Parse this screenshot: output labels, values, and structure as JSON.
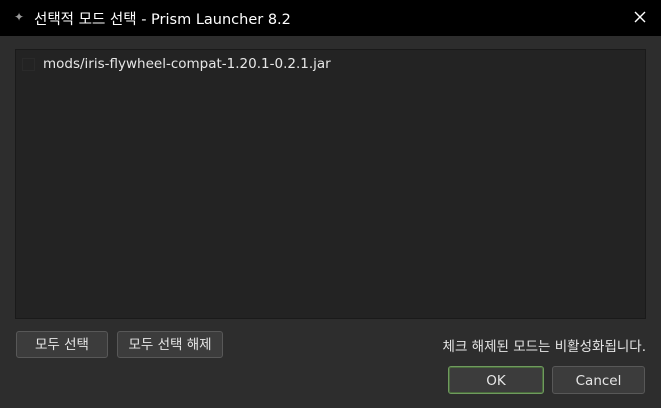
{
  "window": {
    "title": "선택적 모드 선택 - Prism Launcher 8.2",
    "app_icon": "prism-launcher-icon",
    "close_icon": "close-icon"
  },
  "mod_list": {
    "items": [
      {
        "label": "mods/iris-flywheel-compat-1.20.1-0.2.1.jar",
        "checked": false
      }
    ]
  },
  "buttons": {
    "select_all": "모두 선택",
    "deselect_all": "모두 선택 해제",
    "ok": "OK",
    "cancel": "Cancel"
  },
  "hint_text": "체크 해제된 모드는 비활성화됩니다.",
  "colors": {
    "titlebar": "#000000",
    "background": "#2d2d2d",
    "list_background": "#232323",
    "ok_border": "#6f9b5e"
  }
}
